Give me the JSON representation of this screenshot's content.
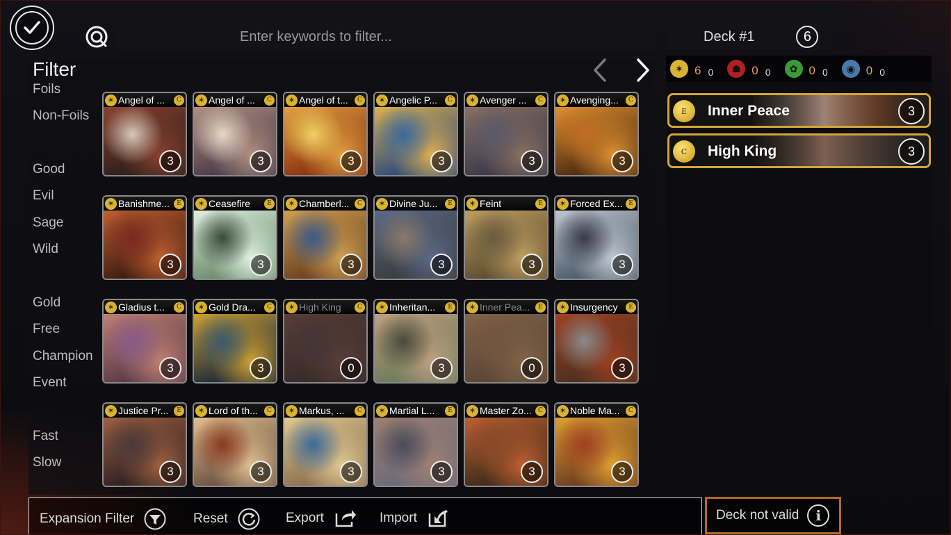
{
  "search": {
    "placeholder": "Enter keywords to filter..."
  },
  "deck": {
    "name": "Deck #1",
    "count": "6"
  },
  "filter": {
    "title": "Filter",
    "items": [
      "Foils",
      "Non-Foils",
      "Good",
      "Evil",
      "Sage",
      "Wild",
      "Gold",
      "Free",
      "Champion",
      "Event",
      "Fast",
      "Slow"
    ]
  },
  "factions": [
    {
      "icon": "good-faction-icon",
      "value": "6",
      "sub": "0",
      "color": "#d9b332",
      "valueColor": "#e0a060"
    },
    {
      "icon": "evil-faction-icon",
      "value": "0",
      "sub": "0",
      "color": "#b02020",
      "valueColor": "#e0a060"
    },
    {
      "icon": "wild-faction-icon",
      "value": "0",
      "sub": "0",
      "color": "#3a9a3a",
      "valueColor": "#e0a060"
    },
    {
      "icon": "sage-faction-icon",
      "value": "0",
      "sub": "0",
      "color": "#4a7aa8",
      "valueColor": "#e0a060"
    }
  ],
  "cards": [
    {
      "name": "Angel of ...",
      "rarity": "C",
      "qty": "3"
    },
    {
      "name": "Angel of ...",
      "rarity": "C",
      "qty": "3"
    },
    {
      "name": "Angel of t...",
      "rarity": "C",
      "qty": "3"
    },
    {
      "name": "Angelic P...",
      "rarity": "C",
      "qty": "3"
    },
    {
      "name": "Avenger ...",
      "rarity": "C",
      "qty": "3"
    },
    {
      "name": "Avenging...",
      "rarity": "C",
      "qty": "3"
    },
    {
      "name": "Banishme...",
      "rarity": "E",
      "qty": "3"
    },
    {
      "name": "Ceasefire",
      "rarity": "E",
      "qty": "3"
    },
    {
      "name": "Chamberl...",
      "rarity": "C",
      "qty": "3"
    },
    {
      "name": "Divine Ju...",
      "rarity": "E",
      "qty": "3"
    },
    {
      "name": "Feint",
      "rarity": "E",
      "qty": "3"
    },
    {
      "name": "Forced Ex...",
      "rarity": "E",
      "qty": "3"
    },
    {
      "name": "Gladius t...",
      "rarity": "C",
      "qty": "3"
    },
    {
      "name": "Gold Dra...",
      "rarity": "C",
      "qty": "3"
    },
    {
      "name": "High King",
      "rarity": "C",
      "qty": "0",
      "dim": true
    },
    {
      "name": "Inheritan...",
      "rarity": "E",
      "qty": "3"
    },
    {
      "name": "Inner Pea...",
      "rarity": "E",
      "qty": "0",
      "dim": true
    },
    {
      "name": "Insurgency",
      "rarity": "E",
      "qty": "3"
    },
    {
      "name": "Justice Pr...",
      "rarity": "E",
      "qty": "3"
    },
    {
      "name": "Lord of th...",
      "rarity": "C",
      "qty": "3"
    },
    {
      "name": "Markus, ...",
      "rarity": "C",
      "qty": "3"
    },
    {
      "name": "Martial L...",
      "rarity": "E",
      "qty": "3"
    },
    {
      "name": "Master Zo...",
      "rarity": "C",
      "qty": "3"
    },
    {
      "name": "Noble Ma...",
      "rarity": "C",
      "qty": "3"
    }
  ],
  "deck_cards": [
    {
      "name": "Inner Peace",
      "rarity": "E",
      "qty": "3"
    },
    {
      "name": "High King",
      "rarity": "C",
      "qty": "3"
    }
  ],
  "toolbar": {
    "expansion_filter": "Expansion Filter",
    "reset": "Reset",
    "export": "Export",
    "import": "Import"
  },
  "status": {
    "deck_valid": "Deck not valid",
    "info_glyph": "i"
  }
}
